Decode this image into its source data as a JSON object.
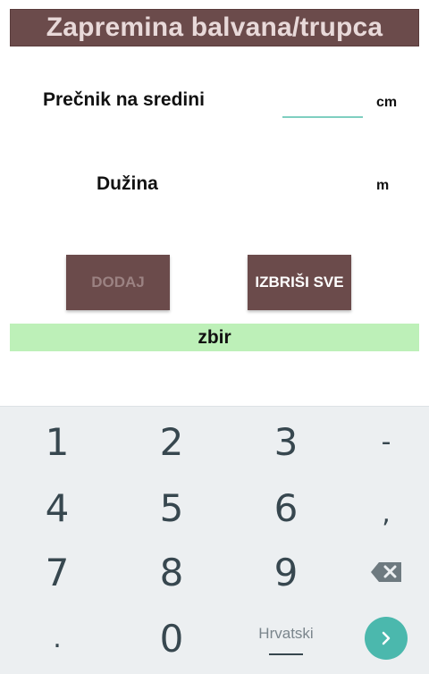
{
  "app": {
    "title": "Zapremina balvana/trupca"
  },
  "form": {
    "diameter_label": "Prečnik na sredini",
    "diameter_unit": "cm",
    "diameter_value": "",
    "length_label": "Dužina",
    "length_unit": "m",
    "length_value": ""
  },
  "buttons": {
    "add_label": "DODAJ",
    "clear_label": "IZBRIŠI SVE"
  },
  "summary": {
    "label": "zbir"
  },
  "keyboard": {
    "keys": {
      "k1": "1",
      "k2": "2",
      "k3": "3",
      "minus": "-",
      "k4": "4",
      "k5": "5",
      "k6": "6",
      "comma": ",",
      "k7": "7",
      "k8": "8",
      "k9": "9",
      "dot": ".",
      "k0": "0"
    },
    "language_label": "Hrvatski"
  },
  "colors": {
    "title_bg": "#6b4b4b",
    "summary_bg": "#bdf0b8",
    "accent": "#4bb8ad",
    "keyboard_bg": "#eceff1"
  }
}
